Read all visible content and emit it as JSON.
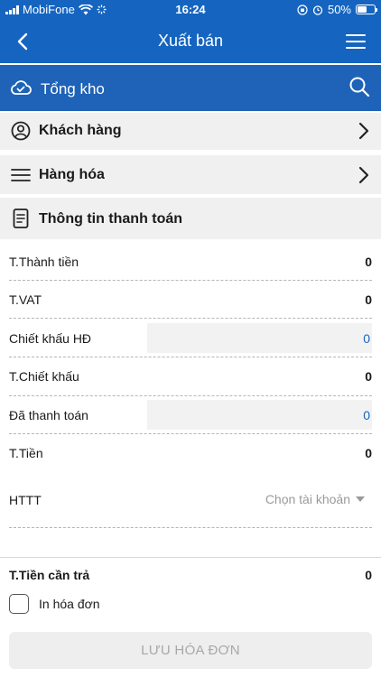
{
  "status_bar": {
    "carrier": "MobiFone",
    "time": "16:24",
    "battery_percent": "50%",
    "battery_level": 0.5
  },
  "header": {
    "title": "Xuất bán"
  },
  "warehouse": {
    "label": "Tổng kho"
  },
  "sections": {
    "customer": "Khách hàng",
    "goods": "Hàng hóa",
    "payment_info": "Thông tin thanh toán"
  },
  "payment": {
    "rows": [
      {
        "label": "T.Thành tiền",
        "value": "0"
      },
      {
        "label": "T.VAT",
        "value": "0"
      },
      {
        "label": "Chiết khấu HĐ",
        "value": "0"
      },
      {
        "label": "T.Chiết khấu",
        "value": "0"
      },
      {
        "label": "Đã thanh toán",
        "value": "0"
      },
      {
        "label": "T.Tiền",
        "value": "0"
      }
    ],
    "httt_label": "HTTT",
    "httt_placeholder": "Chọn tài khoản",
    "total_due_label": "T.Tiền cần trả",
    "total_due_value": "0"
  },
  "print_invoice": {
    "label": "In hóa đơn",
    "checked": false
  },
  "save_button": "LƯU HÓA ĐƠN",
  "colors": {
    "primary": "#1565c0",
    "warehouse_bar": "#1e63b8",
    "section_bg": "#f0f0f0",
    "link_value": "#1565c0"
  }
}
